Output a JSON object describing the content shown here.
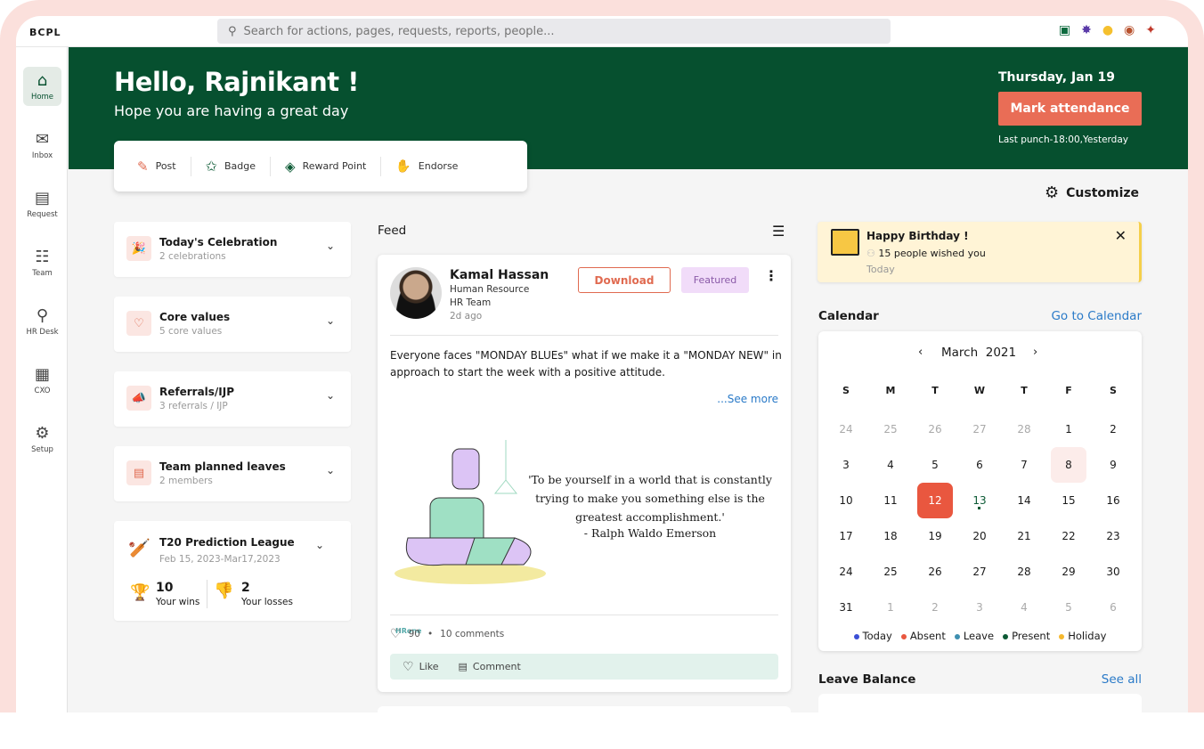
{
  "brand": "BCPL",
  "search": {
    "placeholder": "Search for actions, pages, requests, reports, people..."
  },
  "top_icons": [
    "store-icon",
    "badge-icon",
    "bulb-icon",
    "medal-icon",
    "pin-icon"
  ],
  "sidebar": {
    "items": [
      {
        "label": "Home",
        "icon": "home-icon",
        "active": true
      },
      {
        "label": "Inbox",
        "icon": "inbox-icon"
      },
      {
        "label": "Request",
        "icon": "request-icon"
      },
      {
        "label": "Team",
        "icon": "team-icon"
      },
      {
        "label": "HR Desk",
        "icon": "hr-desk-icon"
      },
      {
        "label": "CXO",
        "icon": "cxo-icon"
      },
      {
        "label": "Setup",
        "icon": "setup-icon"
      }
    ]
  },
  "banner": {
    "greeting": "Hello, Rajnikant !",
    "subtitle": "Hope you are having a great day",
    "date": "Thursday, Jan 19",
    "mark_attendance": "Mark attendance",
    "last_punch": "Last punch-18:00,Yesterday",
    "color": "#06502f"
  },
  "actions": [
    {
      "label": "Post",
      "icon": "pencil-icon"
    },
    {
      "label": "Badge",
      "icon": "star-badge-icon"
    },
    {
      "label": "Reward Point",
      "icon": "reward-icon"
    },
    {
      "label": "Endorse",
      "icon": "thumbs-up-icon"
    }
  ],
  "customize": "Customize",
  "left_cards": [
    {
      "title": "Today's Celebration",
      "sub": "2 celebrations"
    },
    {
      "title": "Core values",
      "sub": "5 core values"
    },
    {
      "title": "Referrals/IJP",
      "sub": "3 referrals / IJP"
    },
    {
      "title": "Team planned leaves",
      "sub": "2 members"
    }
  ],
  "t20": {
    "title": "T20 Prediction League",
    "dates": "Feb 15, 2023-Mar17,2023",
    "wins": "10",
    "wins_label": "Your wins",
    "losses": "2",
    "losses_label": "Your losses"
  },
  "feed": {
    "title": "Feed",
    "post": {
      "name": "Kamal Hassan",
      "dept": "Human Resource",
      "team": "HR Team",
      "time": "2d ago",
      "download": "Download",
      "featured": "Featured",
      "text": "Everyone faces \"MONDAY BLUEs\" what if we make it a \"MONDAY NEW\" in approach to start the week with a positive attitude.",
      "see_more": "...See more",
      "image_logo": "HRone",
      "quote": "'To be yourself in a world that is constantly trying to make you something else is the greatest accomplishment.'",
      "quote_author": "- Ralph Waldo Emerson",
      "likes": "90",
      "comments": "10 comments",
      "like": "Like",
      "comment": "Comment"
    }
  },
  "birthday": {
    "title": "Happy Birthday !",
    "wishes": "15 people wished you",
    "time": "Today"
  },
  "calendar": {
    "title": "Calendar",
    "link": "Go to Calendar",
    "month": "March  2021",
    "weekdays": [
      "S",
      "M",
      "T",
      "W",
      "T",
      "F",
      "S"
    ],
    "weeks": [
      [
        "24",
        "25",
        "26",
        "27",
        "28",
        "1",
        "2"
      ],
      [
        "3",
        "4",
        "5",
        "6",
        "7",
        "8",
        "9"
      ],
      [
        "10",
        "11",
        "12",
        "13",
        "14",
        "15",
        "16"
      ],
      [
        "17",
        "18",
        "19",
        "20",
        "21",
        "22",
        "23"
      ],
      [
        "24",
        "25",
        "26",
        "27",
        "28",
        "29",
        "30"
      ],
      [
        "31",
        "1",
        "2",
        "3",
        "4",
        "5",
        "6"
      ]
    ],
    "absent_day": "12",
    "leave_day": "8",
    "present_day": "13",
    "legend": [
      {
        "label": "Today",
        "color": "#3b4fd6"
      },
      {
        "label": "Absent",
        "color": "#e9573f"
      },
      {
        "label": "Leave",
        "color": "#3e8fb0"
      },
      {
        "label": "Present",
        "color": "#0c5a35"
      },
      {
        "label": "Holiday",
        "color": "#f5b82e"
      }
    ]
  },
  "leave": {
    "title": "Leave Balance",
    "link": "See all"
  }
}
